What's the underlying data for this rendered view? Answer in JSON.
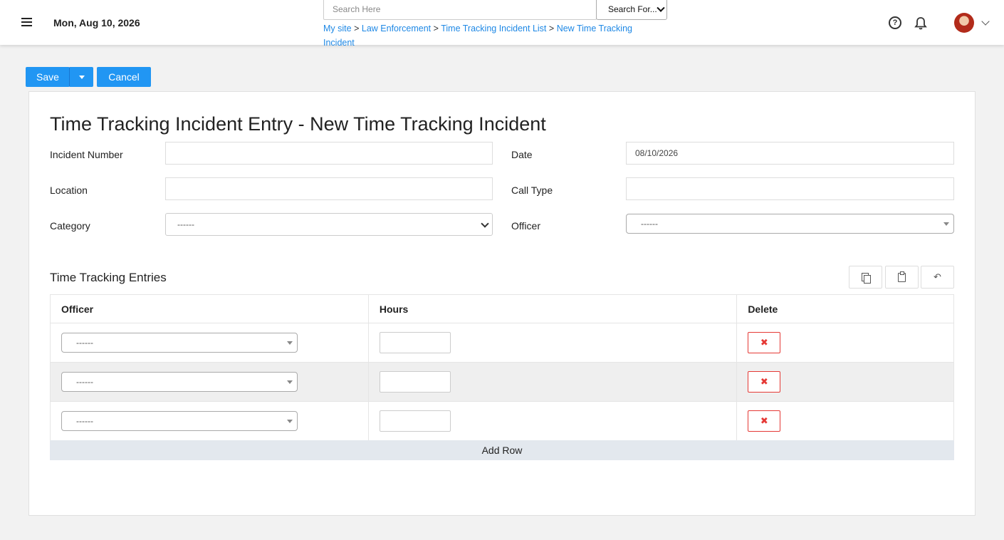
{
  "header": {
    "date": "Mon, Aug 10, 2026",
    "search": {
      "placeholder": "Search Here",
      "scope_selected": "Search For..."
    },
    "breadcrumb": [
      "My site",
      "Law Enforcement",
      "Time Tracking Incident List",
      "New Time Tracking Incident"
    ],
    "breadcrumb_separator": ">"
  },
  "toolbar": {
    "save_label": "Save",
    "cancel_label": "Cancel"
  },
  "form": {
    "title": "Time Tracking Incident Entry - New Time Tracking Incident",
    "incident_number": {
      "label": "Incident Number",
      "value": ""
    },
    "date": {
      "label": "Date",
      "value": "08/10/2026"
    },
    "location": {
      "label": "Location",
      "value": ""
    },
    "call_type": {
      "label": "Call Type",
      "value": ""
    },
    "category": {
      "label": "Category",
      "value": "------"
    },
    "officer": {
      "label": "Officer",
      "value": "------"
    }
  },
  "entries": {
    "title": "Time Tracking Entries",
    "tools": [
      "copy-icon",
      "paste-icon",
      "undo-icon"
    ],
    "columns": [
      "Officer",
      "Hours",
      "Delete"
    ],
    "rows": [
      {
        "officer": "------",
        "hours": ""
      },
      {
        "officer": "------",
        "hours": ""
      },
      {
        "officer": "------",
        "hours": ""
      }
    ],
    "delete_glyph": "✖",
    "add_row_label": "Add Row"
  },
  "colors": {
    "accent": "#2196f3",
    "link": "#1e88e5",
    "danger": "#e53935",
    "background": "#f2f2f2"
  }
}
